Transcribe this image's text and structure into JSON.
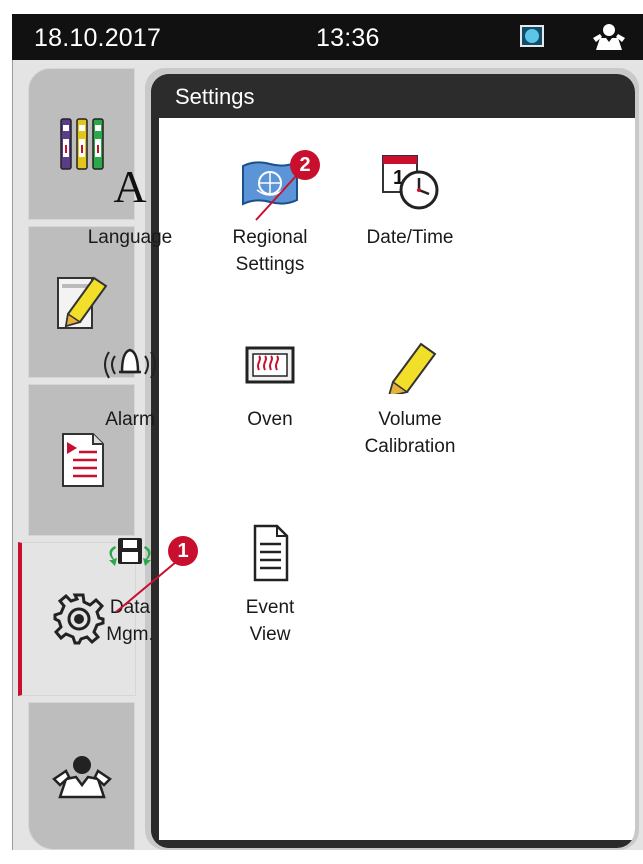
{
  "status_bar": {
    "date": "18.10.2017",
    "time": "13:36",
    "device_icon": "device-status-icon",
    "user_icon": "user-icon"
  },
  "nav": {
    "tabs": [
      {
        "name": "reagents",
        "icon": "reagent-stations-icon"
      },
      {
        "name": "reagent-edit",
        "icon": "pencil-tablet-icon"
      },
      {
        "name": "programs",
        "icon": "program-list-icon"
      },
      {
        "name": "settings",
        "icon": "gear-icon",
        "active": true
      },
      {
        "name": "user",
        "icon": "user-icon"
      }
    ]
  },
  "settings": {
    "title": "Settings",
    "items": [
      {
        "id": "language",
        "label": "Language",
        "icon": "letter-a-icon"
      },
      {
        "id": "regional",
        "label_line1": "Regional",
        "label_line2": "Settings",
        "icon": "globe-flag-icon"
      },
      {
        "id": "datetime",
        "label": "Date/Time",
        "icon": "calendar-clock-icon"
      },
      {
        "id": "alarm",
        "label": "Alarm",
        "icon": "bell-icon"
      },
      {
        "id": "oven",
        "label": "Oven",
        "icon": "oven-icon"
      },
      {
        "id": "volume",
        "label_line1": "Volume",
        "label_line2": "Calibration",
        "icon": "marker-icon"
      },
      {
        "id": "data",
        "label_line1": "Data",
        "label_line2": "Mgm.",
        "icon": "floppy-sync-icon"
      },
      {
        "id": "event",
        "label_line1": "Event",
        "label_line2": "View",
        "icon": "document-icon"
      }
    ]
  },
  "callouts": {
    "one": "1",
    "two": "2"
  },
  "colors": {
    "accent_red": "#c8102e",
    "header_dark": "#2c2c2c",
    "tab_gray": "#bdbdbd"
  }
}
